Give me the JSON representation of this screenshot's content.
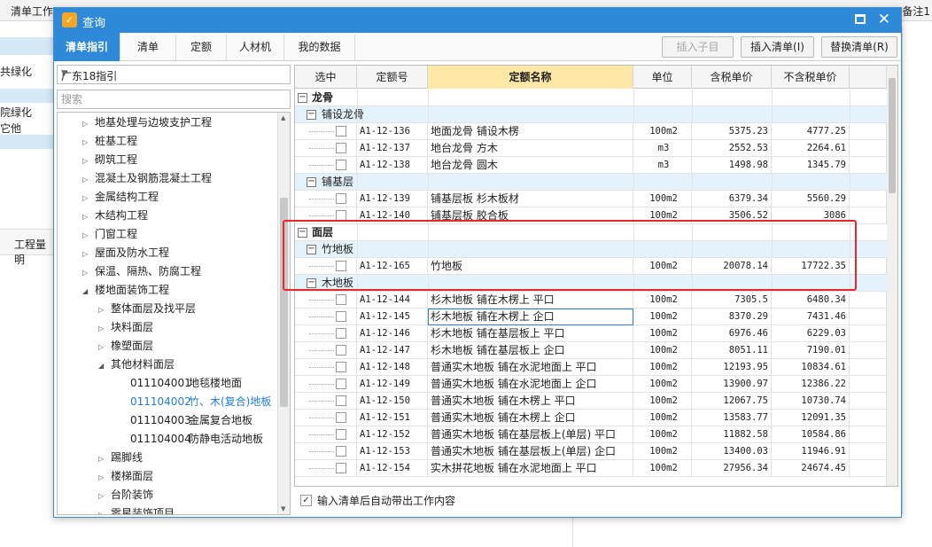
{
  "background": {
    "top_left": "清单工作",
    "top_right": "备注1",
    "side_items": [
      "共绿化",
      "院绿化",
      "它他"
    ],
    "tab_label": "工程量明"
  },
  "dialog": {
    "title": "查询",
    "icon": "app-check-icon",
    "tabs": [
      "清单指引",
      "清单",
      "定额",
      "人材机",
      "我的数据"
    ],
    "buttons": {
      "insert_child": "插入子目",
      "insert_list": "插入清单(I)",
      "replace_list": "替换清单(R)"
    }
  },
  "left_panel": {
    "combo_value": "广东18指引",
    "search_placeholder": "搜索",
    "tree": [
      {
        "label": "地基处理与边坡支护工程",
        "level": 1,
        "arrow": "▷"
      },
      {
        "label": "桩基工程",
        "level": 1,
        "arrow": "▷"
      },
      {
        "label": "砌筑工程",
        "level": 1,
        "arrow": "▷"
      },
      {
        "label": "混凝土及钢筋混凝土工程",
        "level": 1,
        "arrow": "▷"
      },
      {
        "label": "金属结构工程",
        "level": 1,
        "arrow": "▷"
      },
      {
        "label": "木结构工程",
        "level": 1,
        "arrow": "▷"
      },
      {
        "label": "门窗工程",
        "level": 1,
        "arrow": "▷"
      },
      {
        "label": "屋面及防水工程",
        "level": 1,
        "arrow": "▷"
      },
      {
        "label": "保温、隔热、防腐工程",
        "level": 1,
        "arrow": "▷"
      },
      {
        "label": "楼地面装饰工程",
        "level": 1,
        "arrow": "◢"
      },
      {
        "label": "整体面层及找平层",
        "level": 2,
        "arrow": "▷"
      },
      {
        "label": "块料面层",
        "level": 2,
        "arrow": "▷"
      },
      {
        "label": "橡塑面层",
        "level": 2,
        "arrow": "▷"
      },
      {
        "label": "其他材料面层",
        "level": 2,
        "arrow": "◢"
      },
      {
        "code": "011104001",
        "label": "地毯楼地面",
        "level": 3
      },
      {
        "code": "011104002",
        "label": "竹、木(复合)地板",
        "level": 3,
        "selected": true
      },
      {
        "code": "011104003",
        "label": "金属复合地板",
        "level": 3
      },
      {
        "code": "011104004",
        "label": "防静电活动地板",
        "level": 3
      },
      {
        "label": "踢脚线",
        "level": 2,
        "arrow": "▷"
      },
      {
        "label": "楼梯面层",
        "level": 2,
        "arrow": "▷"
      },
      {
        "label": "台阶装饰",
        "level": 2,
        "arrow": "▷"
      },
      {
        "label": "零星装饰项目",
        "level": 2,
        "arrow": "▷"
      }
    ]
  },
  "table": {
    "headers": [
      "选中",
      "定额号",
      "定额名称",
      "单位",
      "含税单价",
      "不含税单价"
    ],
    "rows": [
      {
        "type": "cat",
        "label": "龙骨"
      },
      {
        "type": "sub",
        "label": "铺设龙骨"
      },
      {
        "type": "item",
        "code": "A1-12-136",
        "name": "地面龙骨 铺设木楞",
        "unit": "100m2",
        "price_tax": "5375.23",
        "price_notax": "4777.25"
      },
      {
        "type": "item",
        "code": "A1-12-137",
        "name": "地台龙骨 方木",
        "unit": "m3",
        "price_tax": "2552.53",
        "price_notax": "2264.61"
      },
      {
        "type": "item",
        "code": "A1-12-138",
        "name": "地台龙骨 圆木",
        "unit": "m3",
        "price_tax": "1498.98",
        "price_notax": "1345.79"
      },
      {
        "type": "sub",
        "label": "铺基层"
      },
      {
        "type": "item",
        "code": "A1-12-139",
        "name": "铺基层板 杉木板材",
        "unit": "100m2",
        "price_tax": "6379.34",
        "price_notax": "5560.29"
      },
      {
        "type": "item",
        "code": "A1-12-140",
        "name": "铺基层板 胶合板",
        "unit": "100m2",
        "price_tax": "3506.52",
        "price_notax": "3086"
      },
      {
        "type": "cat",
        "label": "面层"
      },
      {
        "type": "sub",
        "label": "竹地板"
      },
      {
        "type": "item",
        "code": "A1-12-165",
        "name": "竹地板",
        "unit": "100m2",
        "price_tax": "20078.14",
        "price_notax": "17722.35"
      },
      {
        "type": "sub",
        "label": "木地板"
      },
      {
        "type": "item",
        "code": "A1-12-144",
        "name": "杉木地板 铺在木楞上 平口",
        "unit": "100m2",
        "price_tax": "7305.5",
        "price_notax": "6480.34"
      },
      {
        "type": "item",
        "code": "A1-12-145",
        "name": "杉木地板 铺在木楞上 企口",
        "unit": "100m2",
        "price_tax": "8370.29",
        "price_notax": "7431.46",
        "focus": true
      },
      {
        "type": "item",
        "code": "A1-12-146",
        "name": "杉木地板 铺在基层板上 平口",
        "unit": "100m2",
        "price_tax": "6976.46",
        "price_notax": "6229.03"
      },
      {
        "type": "item",
        "code": "A1-12-147",
        "name": "杉木地板 铺在基层板上 企口",
        "unit": "100m2",
        "price_tax": "8051.11",
        "price_notax": "7190.01"
      },
      {
        "type": "item",
        "code": "A1-12-148",
        "name": "普通实木地板 铺在水泥地面上 平口",
        "unit": "100m2",
        "price_tax": "12193.95",
        "price_notax": "10834.61"
      },
      {
        "type": "item",
        "code": "A1-12-149",
        "name": "普通实木地板 铺在水泥地面上 企口",
        "unit": "100m2",
        "price_tax": "13900.97",
        "price_notax": "12386.22"
      },
      {
        "type": "item",
        "code": "A1-12-150",
        "name": "普通实木地板 铺在木楞上 平口",
        "unit": "100m2",
        "price_tax": "12067.75",
        "price_notax": "10730.74"
      },
      {
        "type": "item",
        "code": "A1-12-151",
        "name": "普通实木地板 铺在木楞上 企口",
        "unit": "100m2",
        "price_tax": "13583.77",
        "price_notax": "12091.35"
      },
      {
        "type": "item",
        "code": "A1-12-152",
        "name": "普通实木地板 铺在基层板上(单层) 平口",
        "unit": "100m2",
        "price_tax": "11882.58",
        "price_notax": "10584.86"
      },
      {
        "type": "item",
        "code": "A1-12-153",
        "name": "普通实木地板 铺在基层板上(单层) 企口",
        "unit": "100m2",
        "price_tax": "13400.03",
        "price_notax": "11946.91"
      },
      {
        "type": "item",
        "code": "A1-12-154",
        "name": "实木拼花地板 铺在水泥地面上 平口",
        "unit": "100m2",
        "price_tax": "27956.34",
        "price_notax": "24674.45"
      }
    ]
  },
  "footer": {
    "auto_bring_label": "输入清单后自动带出工作内容",
    "auto_bring_checked": true
  },
  "colors": {
    "accent": "#2e8ad8",
    "header_highlight": "#fde8a8",
    "subrow": "#e4f2fc",
    "annotation_box": "#e8272b"
  }
}
